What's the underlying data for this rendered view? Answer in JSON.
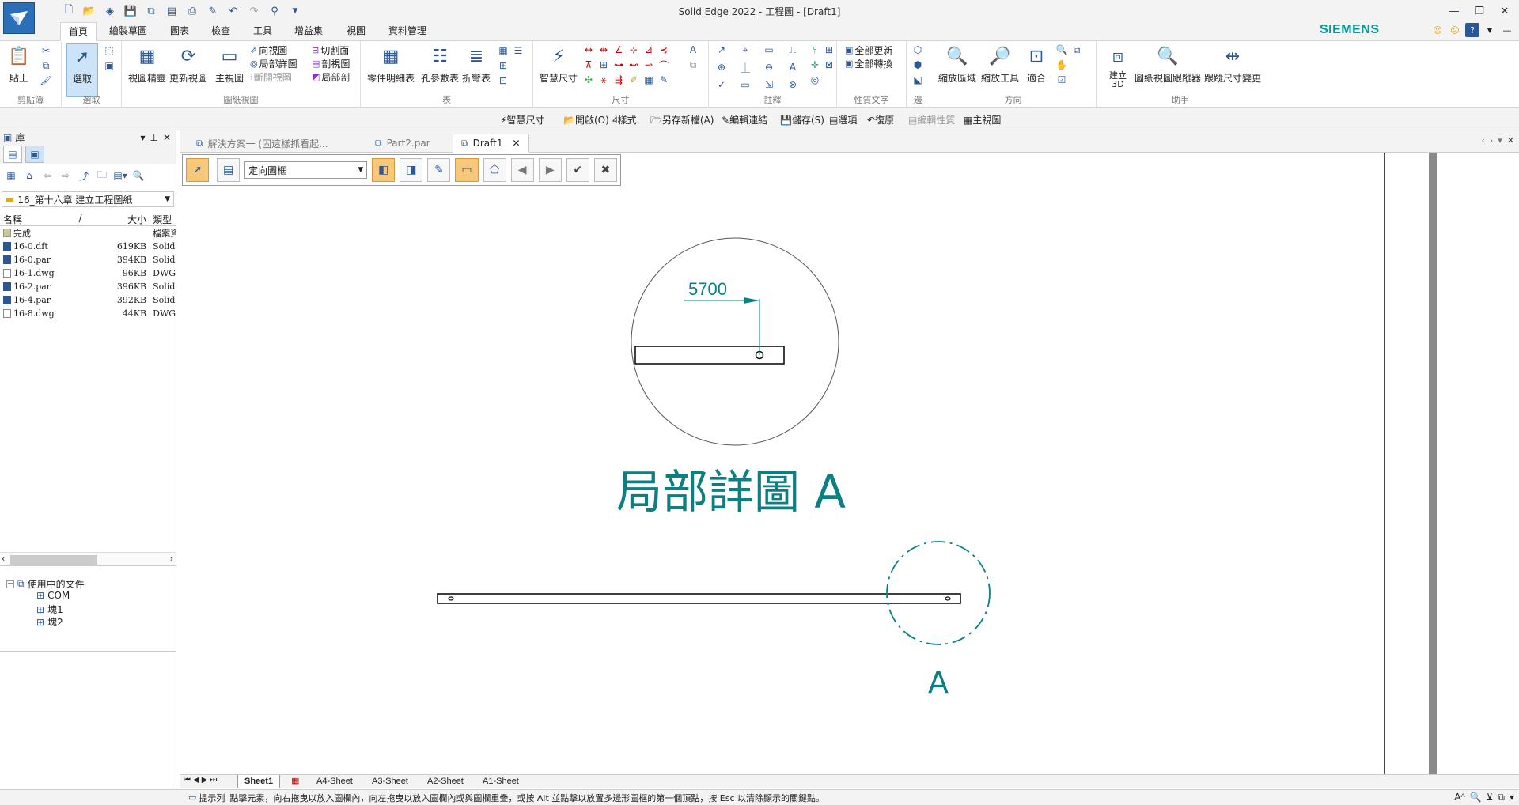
{
  "window": {
    "title": "Solid Edge 2022 - 工程圖 - [Draft1]"
  },
  "brand": {
    "name": "SIEMENS",
    "color": "#009999"
  },
  "ribbon_tabs": [
    "首頁",
    "繪製草圖",
    "圖表",
    "檢查",
    "工具",
    "增益集",
    "視圖",
    "資料管理"
  ],
  "ribbon": {
    "clipboard": {
      "label": "剪貼簿",
      "paste": "貼上"
    },
    "select": {
      "label": "選取",
      "select": "選取"
    },
    "drawing_views": {
      "label": "圖紙視圖",
      "view_wizard": "視圖精靈",
      "update_view": "更新視圖",
      "main_view": "主視圖",
      "aux_view": "向視圖",
      "detail_view": "局部詳圖",
      "broken_view": "斷開視圖",
      "cut_plane": "切割面",
      "section_view": "剖視圖",
      "partial_section": "局部剖"
    },
    "tables": {
      "label": "表",
      "parts_list": "零件明細表",
      "hole_table": "孔參數表",
      "bend_table": "折彎表"
    },
    "dimension": {
      "label": "尺寸",
      "smart_dimension": "智慧尺寸"
    },
    "annotation": {
      "label": "註釋"
    },
    "property_text": {
      "label": "性質文字",
      "update_all": "全部更新",
      "convert_all": "全部轉換"
    },
    "edge": {
      "label": "邊"
    },
    "orientation": {
      "label": "方向",
      "zoom_area": "縮放區域",
      "zoom_tool": "縮放工具",
      "fit": "適合"
    },
    "assistant": {
      "label": "助手",
      "create_3d": "建立 3D",
      "view_tracker": "圖紙視圖跟蹤器",
      "dim_track": "跟蹤尺寸變更"
    }
  },
  "command_bar": [
    "智慧尺寸",
    "開啟(O)",
    "樣式",
    "另存新檔(A)",
    "編輯連結",
    "儲存(S)",
    "選項",
    "復原",
    "編輯性質",
    "主視圖"
  ],
  "left_panel": {
    "title": "庫",
    "folder": "16_第十六章 建立工程圖紙",
    "columns": {
      "name": "名稱",
      "size": "大小",
      "type": "類型"
    },
    "files": [
      {
        "name": "完成",
        "size": "",
        "type": "檔案資",
        "kind": "folder"
      },
      {
        "name": "16-0.dft",
        "size": "619KB",
        "type": "Solid E",
        "kind": "dft"
      },
      {
        "name": "16-0.par",
        "size": "394KB",
        "type": "Solid E",
        "kind": "par"
      },
      {
        "name": "16-1.dwg",
        "size": "96KB",
        "type": "DWG",
        "kind": "dwg"
      },
      {
        "name": "16-2.par",
        "size": "396KB",
        "type": "Solid E",
        "kind": "par"
      },
      {
        "name": "16-4.par",
        "size": "392KB",
        "type": "Solid E",
        "kind": "par"
      },
      {
        "name": "16-8.dwg",
        "size": "44KB",
        "type": "DWG",
        "kind": "dwg"
      }
    ],
    "tree": {
      "root": "使用中的文件",
      "children": [
        "COM",
        "塊1",
        "塊2"
      ]
    }
  },
  "doc_tabs": [
    "解決方案一 (固這樣抓看起...",
    "Part2.par",
    "Draft1"
  ],
  "command_toolbar": {
    "dropdown": "定向圖框"
  },
  "drawing": {
    "dimension_value": "5700",
    "detail_title": "局部詳圖 A",
    "detail_label": "A",
    "line_color": "#0a7f84"
  },
  "sheet_tabs": [
    "Sheet1",
    "A4-Sheet",
    "A3-Sheet",
    "A2-Sheet",
    "A1-Sheet"
  ],
  "status": {
    "prompt_label": "提示列",
    "prompt_text": "點擊元素，向右拖曳以放入圖欄內，向左拖曳以放入圖欄內或與圖欄重疊，或按 Alt 並點擊以放置多邊形圖框的第一個頂點，按 Esc 以清除顯示的關鍵點。"
  }
}
